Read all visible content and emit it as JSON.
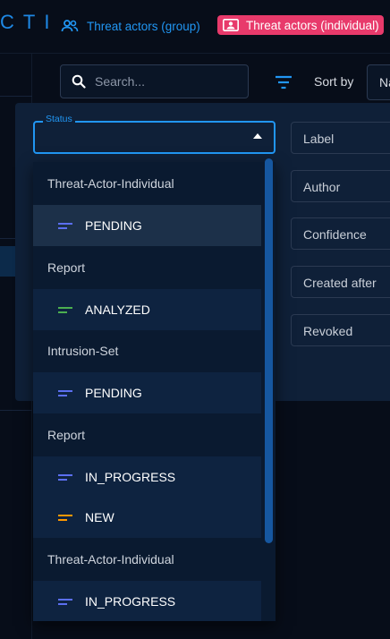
{
  "header": {
    "logo_fragment": "CTI",
    "tabs": [
      {
        "label": "Threat actors (group)",
        "active": false
      },
      {
        "label": "Threat actors (individual)",
        "active": true
      }
    ]
  },
  "toolbar": {
    "search_placeholder": "Search...",
    "sort_label": "Sort by",
    "sort_value": "Name"
  },
  "filters": {
    "status": {
      "label": "Status",
      "value": ""
    },
    "others": [
      {
        "label": "Label"
      },
      {
        "label": "Author"
      },
      {
        "label": "Confidence"
      },
      {
        "label": "Created after"
      },
      {
        "label": "Revoked"
      }
    ]
  },
  "status_options": [
    {
      "kind": "group",
      "label": "Threat-Actor-Individual"
    },
    {
      "kind": "option",
      "label": "PENDING",
      "color": "#5b6ff0",
      "highlighted": true
    },
    {
      "kind": "group",
      "label": "Report"
    },
    {
      "kind": "option",
      "label": "ANALYZED",
      "color": "#4caf50"
    },
    {
      "kind": "group",
      "label": "Intrusion-Set"
    },
    {
      "kind": "option",
      "label": "PENDING",
      "color": "#5b6ff0"
    },
    {
      "kind": "group",
      "label": "Report"
    },
    {
      "kind": "option",
      "label": "IN_PROGRESS",
      "color": "#5b6ff0"
    },
    {
      "kind": "option",
      "label": "NEW",
      "color": "#ff9800"
    },
    {
      "kind": "group",
      "label": "Threat-Actor-Individual"
    },
    {
      "kind": "option",
      "label": "IN_PROGRESS",
      "color": "#5b6ff0"
    }
  ],
  "colors": {
    "accent": "#2196f3",
    "active_tab": "#e83a6b",
    "background": "#070d19",
    "panel": "#0f2038"
  }
}
